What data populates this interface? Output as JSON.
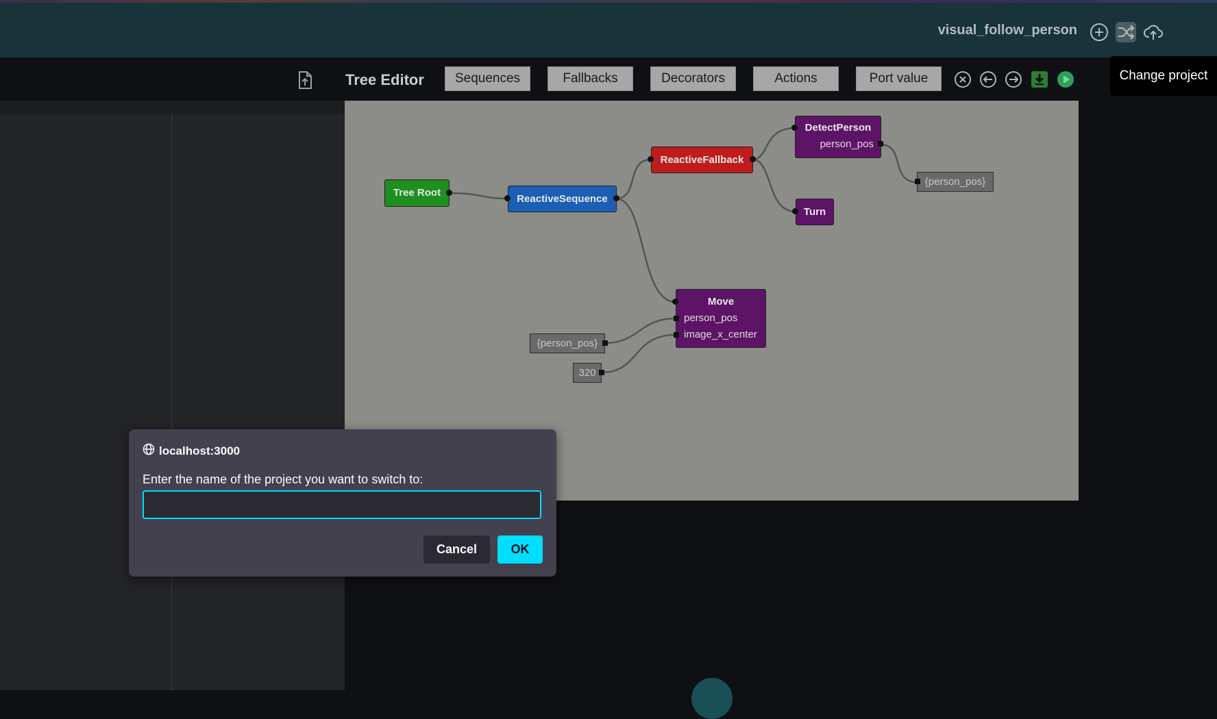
{
  "header": {
    "project_name": "visual_follow_person",
    "icons": [
      "add-circle-icon",
      "shuffle-icon",
      "cloud-upload-icon"
    ]
  },
  "tooltip": {
    "text": "Change project"
  },
  "toolbar": {
    "title": "Tree Editor",
    "buttons": [
      "Sequences",
      "Fallbacks",
      "Decorators",
      "Actions",
      "Port value"
    ],
    "icons": [
      "close-circle-icon",
      "arrow-left-circle-icon",
      "arrow-right-circle-icon",
      "download-icon",
      "play-icon"
    ],
    "download_color": "#2e7d32",
    "play_color": "#2e9e5a"
  },
  "tree": {
    "nodes": {
      "root": {
        "label": "Tree Root",
        "color": "#1f8f1f"
      },
      "seq": {
        "label": "ReactiveSequence",
        "color": "#1a5fb4"
      },
      "fallback": {
        "label": "ReactiveFallback",
        "color": "#c01c1c"
      },
      "detect": {
        "label": "DetectPerson",
        "port": "person_pos",
        "color": "#5e1466"
      },
      "turn": {
        "label": "Turn",
        "color": "#5e1466"
      },
      "move": {
        "label": "Move",
        "ports": [
          "person_pos",
          "image_x_center"
        ],
        "color": "#5e1466"
      }
    },
    "values": {
      "detect_out": "{person_pos}",
      "move_in": "{person_pos}",
      "move_center": "320"
    }
  },
  "dialog": {
    "host": "localhost:3000",
    "message": "Enter the name of the project you want to switch to:",
    "input_value": "",
    "cancel_label": "Cancel",
    "ok_label": "OK"
  }
}
